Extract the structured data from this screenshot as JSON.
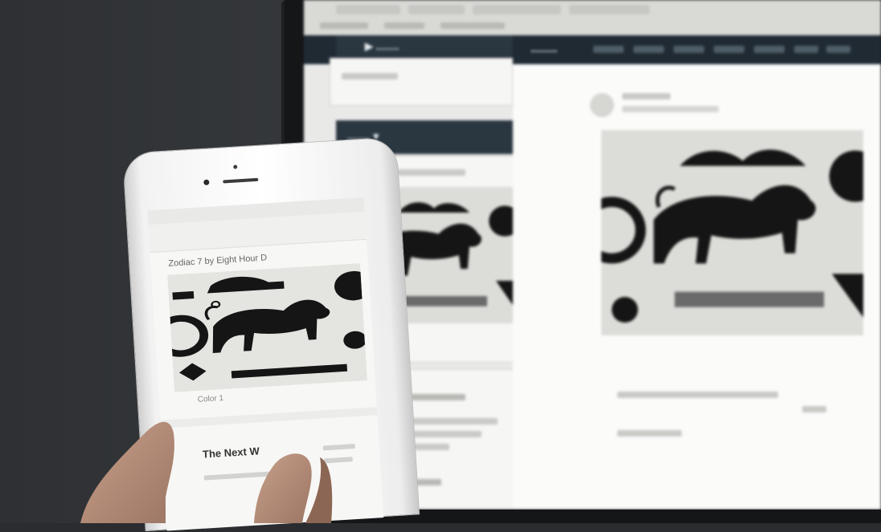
{
  "laptop_app": {
    "brand": "........",
    "column_header": "........ ▾"
  },
  "phone_app": {
    "card_title": "Zodiac 7 by Eight Hour D",
    "card_caption": "Color 1",
    "next_title": "The Next W"
  },
  "colors": {
    "laptop_topbar": "#1f2a33",
    "screen_bg": "#e9e9e8",
    "art_ink": "#151515",
    "art_paper": "#dcdcd8"
  }
}
